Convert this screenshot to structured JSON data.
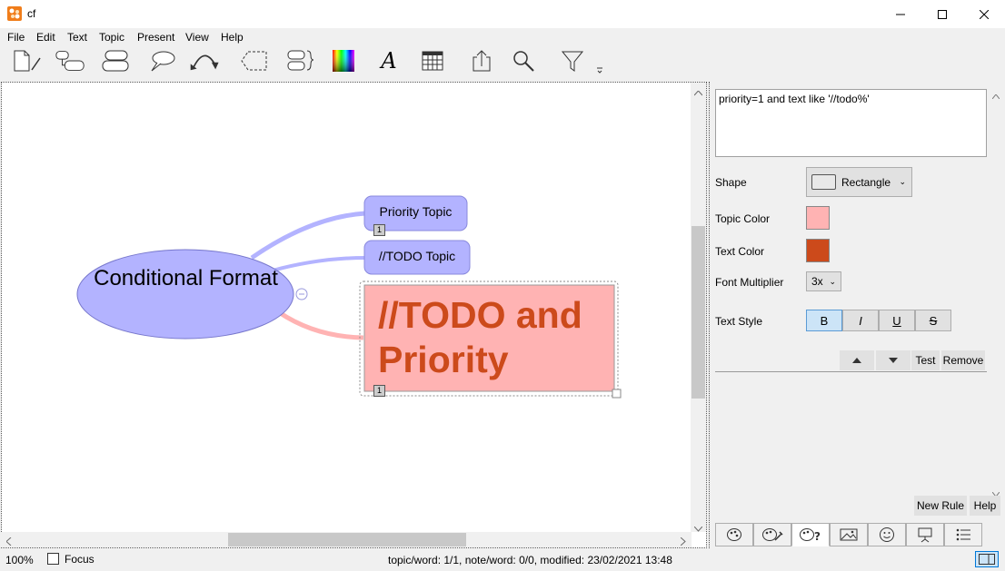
{
  "window": {
    "title": "cf"
  },
  "menu": [
    "File",
    "Edit",
    "Text",
    "Topic",
    "Present",
    "View",
    "Help"
  ],
  "toolbar": {
    "icons": [
      "new-document-icon",
      "add-subtopic-icon",
      "add-topic-icon",
      "callout-icon",
      "relationship-icon",
      "boundary-icon",
      "summary-icon",
      "color-gradient-icon",
      "font-icon",
      "table-icon",
      "export-icon",
      "search-icon",
      "filter-icon"
    ]
  },
  "map": {
    "central": "Conditional Format",
    "topics": [
      {
        "label": "Priority Topic",
        "badge": "1"
      },
      {
        "label": "//TODO Topic"
      },
      {
        "label": "//TODO and Priority",
        "badge": "1"
      }
    ]
  },
  "panel": {
    "filter_expression": "priority=1 and text like '//todo%'",
    "shape_label": "Shape",
    "shape_value": "Rectangle",
    "topic_color_label": "Topic Color",
    "topic_color": "#ffb3b3",
    "text_color_label": "Text Color",
    "text_color": "#cc4a1b",
    "font_multiplier_label": "Font Multiplier",
    "font_multiplier_value": "3x",
    "text_style_label": "Text Style",
    "style_buttons": [
      "B",
      "I",
      "U",
      "S"
    ],
    "test_label": "Test",
    "remove_label": "Remove",
    "new_rule_label": "New Rule",
    "help_label": "Help",
    "tabs": [
      "topic-style-icon",
      "edit-style-icon",
      "conditional-format-icon",
      "image-icon",
      "emoji-icon",
      "presentation-icon",
      "list-icon"
    ]
  },
  "status": {
    "zoom": "100%",
    "focus_label": "Focus",
    "info": "topic/word: 1/1, note/word: 0/0, modified: 23/02/2021 13:48"
  },
  "colors": {
    "central_fill": "#b3b3ff",
    "topic_fill": "#b3b3ff",
    "highlight_fill": "#ffb3b3",
    "highlight_text": "#cc4a1b",
    "link_blue": "#b3b3ff",
    "link_red": "#ffb3b3"
  }
}
